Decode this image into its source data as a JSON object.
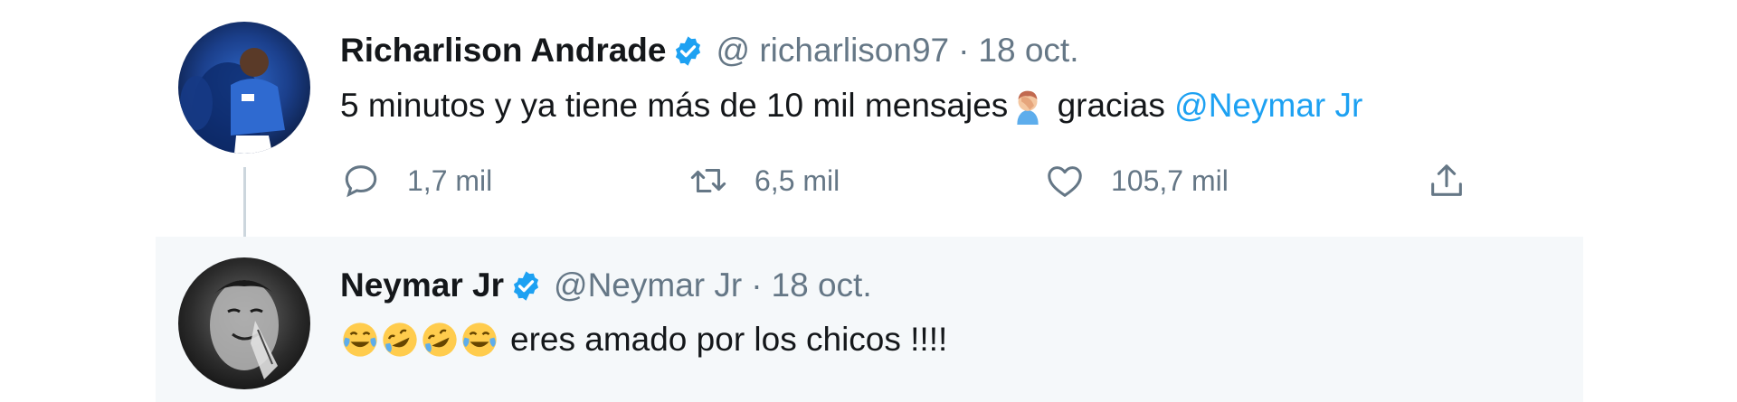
{
  "thread": [
    {
      "display_name": "Richarlison Andrade",
      "handle": "@ richarlison97",
      "separator": "·",
      "date": "18 oct.",
      "text_before": "5 minutos y ya tiene más de 10 mil mensajes",
      "text_after": " gracias ",
      "mention": "@Neymar Jr",
      "emoji_icons": [
        "face-palm-emoji"
      ],
      "actions": {
        "reply_count": "1,7 mil",
        "retweet_count": "6,5 mil",
        "like_count": "105,7 mil"
      }
    },
    {
      "display_name": "Neymar Jr",
      "handle": "@Neymar Jr",
      "separator": "·",
      "date": "18 oct.",
      "text": "eres amado por los chicos !!!!",
      "emoji_icons": [
        "tears-of-joy-emoji",
        "rofl-emoji",
        "rofl-emoji",
        "tears-of-joy-emoji"
      ]
    }
  ],
  "colors": {
    "link": "#1da1f2",
    "secondary_text": "#657786",
    "verified_badge": "#1da1f2",
    "reply_highlight_bg": "#f5f8fa"
  }
}
